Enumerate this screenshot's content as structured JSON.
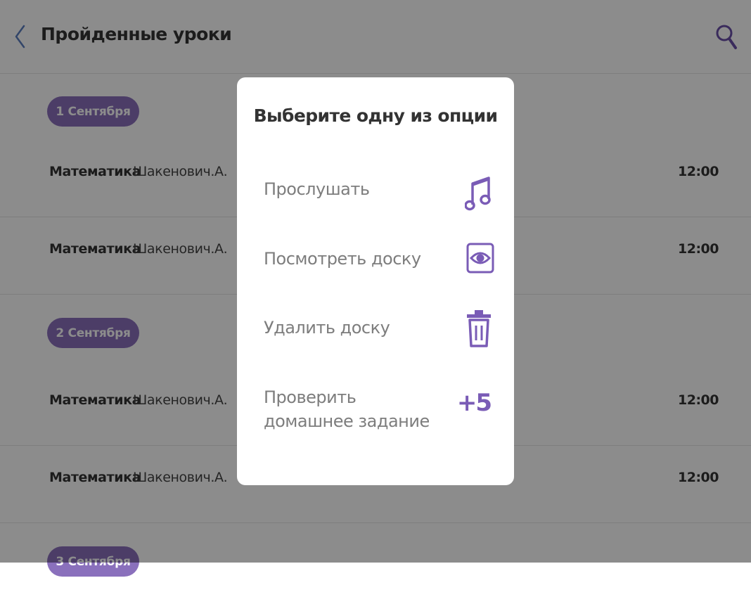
{
  "header": {
    "title": "Пройденные уроки",
    "back_icon": "chevron-left-icon",
    "search_icon": "search-icon"
  },
  "sections": [
    {
      "date": "1 Сентября",
      "lessons": [
        {
          "subject": "Математика",
          "teacher": "Шакенович.А.",
          "time": "12:00"
        },
        {
          "subject": "Математика",
          "teacher": "Шакенович.А.",
          "time": "12:00"
        }
      ]
    },
    {
      "date": "2 Сентября",
      "lessons": [
        {
          "subject": "Математика",
          "teacher": "Шакенович.А.",
          "time": "12:00"
        },
        {
          "subject": "Математика",
          "teacher": "Шакенович.А.",
          "time": "12:00"
        }
      ]
    },
    {
      "date": "3 Сентября",
      "lessons": []
    }
  ],
  "modal": {
    "title": "Выберите одну из опции",
    "options": [
      {
        "label": "Прослушать",
        "icon": "music-note-icon"
      },
      {
        "label": "Посмотреть доску",
        "icon": "eye-icon"
      },
      {
        "label": "Удалить доску",
        "icon": "trash-icon"
      },
      {
        "label": "Проверить домашнее задание",
        "icon": "plus-five-icon",
        "icon_text": "+5"
      }
    ]
  },
  "colors": {
    "accent": "#8a70bc",
    "accent_dark": "#7a5cb6",
    "overlay": "rgba(0,0,0,0.45)"
  }
}
